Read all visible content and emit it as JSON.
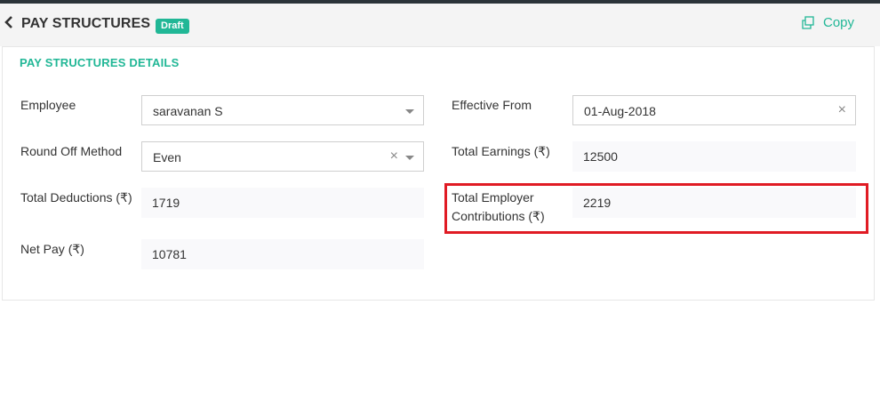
{
  "header": {
    "title": "PAY STRUCTURES :",
    "status_badge": "Draft",
    "copy_label": "Copy"
  },
  "section": {
    "title": "PAY STRUCTURES DETAILS"
  },
  "fields": {
    "employee": {
      "label": "Employee",
      "value": "saravanan S"
    },
    "effective_from": {
      "label": "Effective From",
      "value": "01-Aug-2018"
    },
    "round_off_method": {
      "label": "Round Off Method",
      "value": "Even"
    },
    "total_earnings": {
      "label": "Total Earnings (₹)",
      "value": "12500"
    },
    "total_deductions": {
      "label": "Total Deductions (₹)",
      "value": "1719"
    },
    "total_employer_contributions": {
      "label_line1": "Total Employer",
      "label_line2": "Contributions (₹)",
      "value": "2219"
    },
    "net_pay": {
      "label": "Net Pay (₹)",
      "value": "10781"
    }
  },
  "icons": {
    "back": "chevron-left-icon",
    "copy": "copy-icon",
    "clear": "close-icon",
    "dropdown": "caret-down-icon"
  },
  "colors": {
    "accent": "#21b796",
    "highlight": "#e01b24",
    "top_bar": "#2b3339"
  }
}
